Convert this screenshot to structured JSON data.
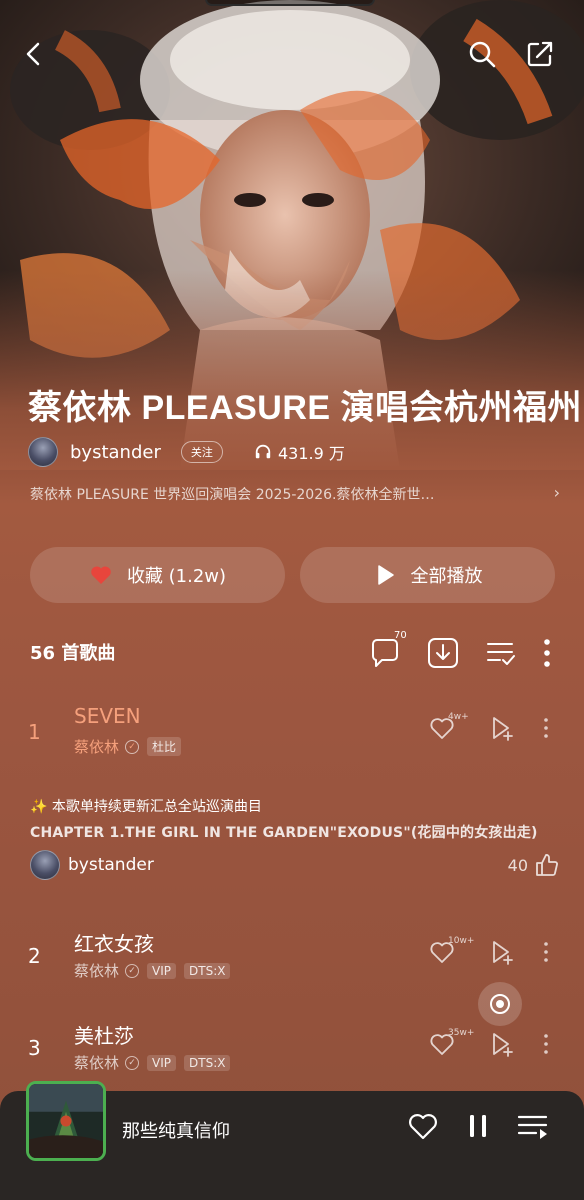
{
  "header": {
    "back_icon": "chevron-left-icon",
    "search_icon": "search-icon",
    "share_icon": "share-icon"
  },
  "playlist": {
    "title": "蔡依林 PLEASURE 演唱会杭州福州",
    "author": "bystander",
    "follow_label": "关注",
    "plays": "431.9 万",
    "description": "蔡依林 PLEASURE 世界巡回演唱会 2025-2026.蔡依林全新世…",
    "description_chevron": "›"
  },
  "actions": {
    "collect_label": "收藏 (1.2w)",
    "play_all_label": "全部播放"
  },
  "list_header": {
    "song_count": "56 首歌曲",
    "comment_count": "70"
  },
  "songs": [
    {
      "index": "1",
      "title": "SEVEN",
      "artist": "蔡依林",
      "tags": [
        "杜比"
      ],
      "likes": "4w+",
      "active": true
    },
    {
      "index": "2",
      "title": "红衣女孩",
      "artist": "蔡依林",
      "tags": [
        "VIP",
        "DTS:X"
      ],
      "likes": "10w+",
      "active": false
    },
    {
      "index": "3",
      "title": "美杜莎",
      "artist": "蔡依林",
      "tags": [
        "VIP",
        "DTS:X"
      ],
      "likes": "35w+",
      "active": false
    }
  ],
  "note": {
    "line1": "✨ 本歌单持续更新汇总全站巡演曲目",
    "line2": "CHAPTER 1.THE GIRL IN THE GARDEN\"EXODUS\"(花园中的女孩出走)",
    "author": "bystander",
    "likes": "40"
  },
  "mini_player": {
    "title": "那些纯真信仰"
  },
  "colors": {
    "accent": "#f5a07c",
    "background": "#8f5038",
    "player_bg": "#2a2624"
  }
}
